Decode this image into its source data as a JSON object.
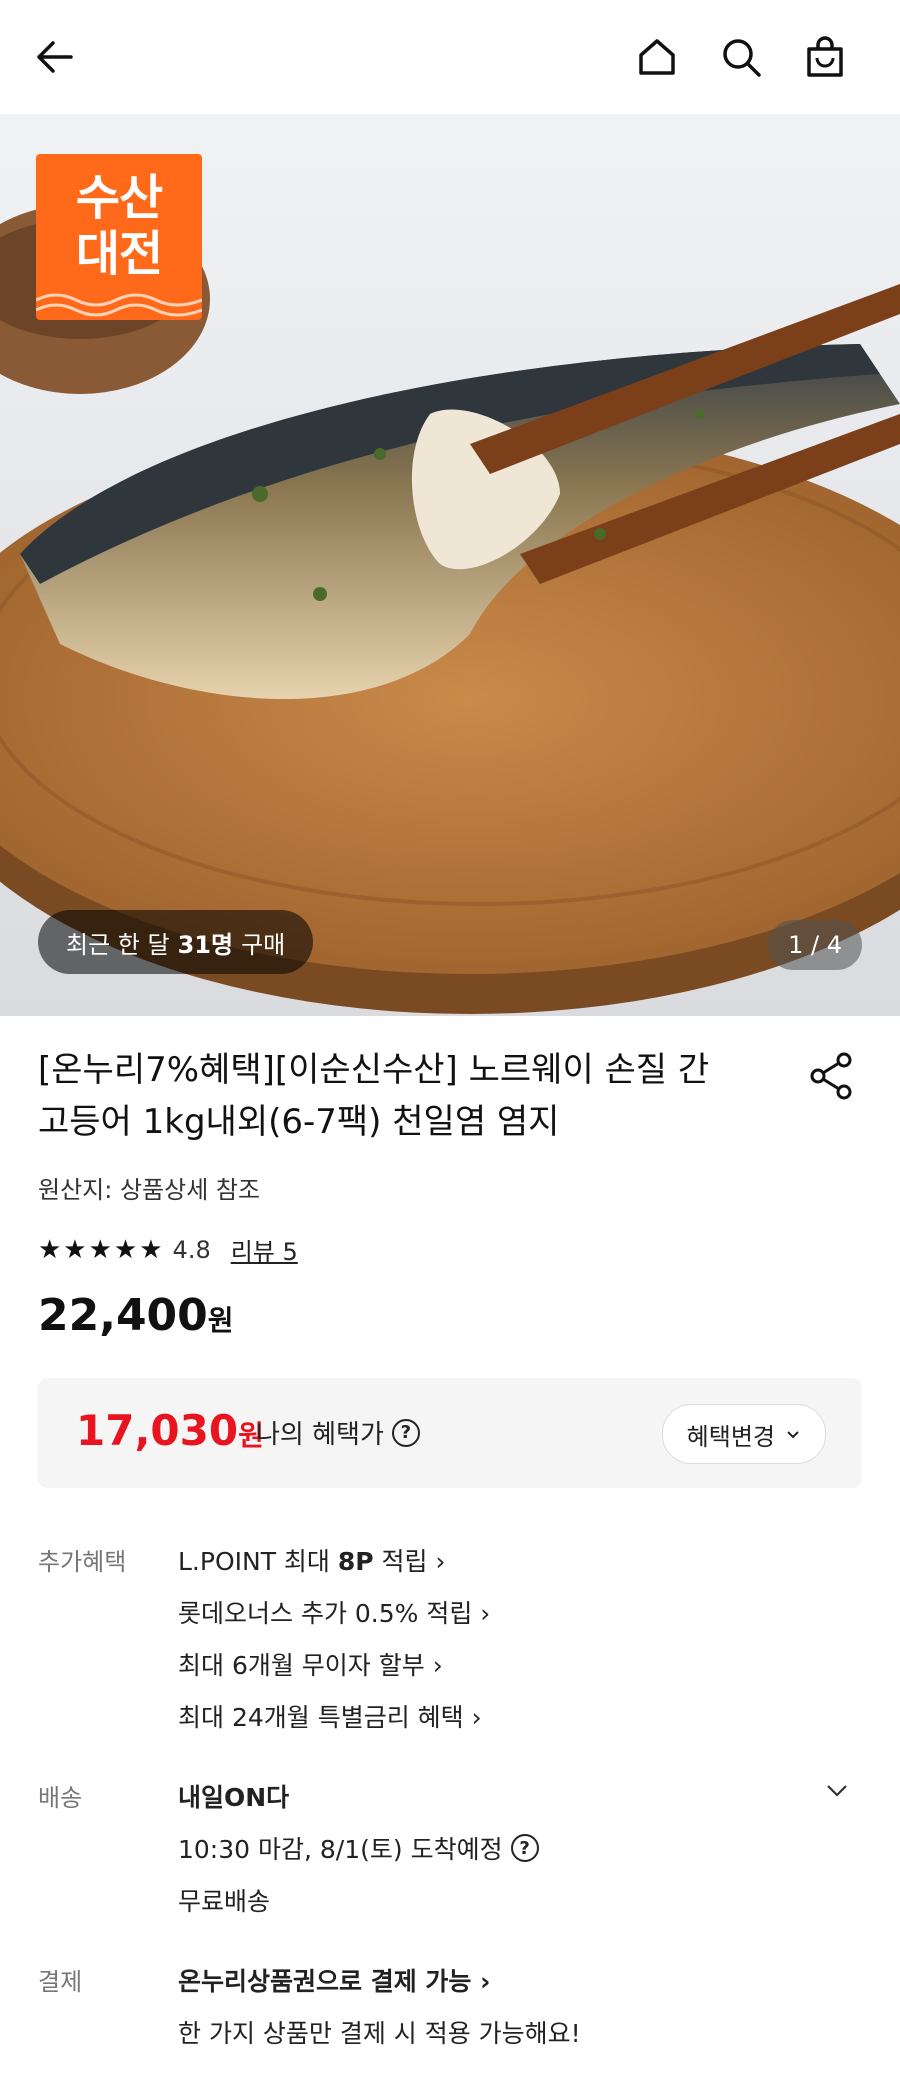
{
  "header": {
    "back_icon": "arrow-left-icon",
    "home_icon": "home-icon",
    "search_icon": "search-icon",
    "cart_icon": "shopping-bag-icon"
  },
  "hero": {
    "badge_line1": "수산",
    "badge_line2": "대전",
    "recent_prefix": "최근 한 달",
    "recent_count": "31명",
    "recent_suffix": "구매",
    "counter": "1 / 4",
    "badge_color": "#ff6a1a"
  },
  "product": {
    "title_line1": "[온누리7%혜택][이순신수산] 노르웨이 손질 간",
    "title_line2": "고등어 1kg내외(6-7팩) 천일염 염지",
    "origin": "원산지: 상품상세 참조",
    "stars": "★★★★★",
    "rating": "4.8",
    "reviews": "리뷰 5",
    "price": "22,400",
    "price_unit": "원"
  },
  "benefit": {
    "price": "17,030",
    "unit": "원",
    "label": "나의 혜택가",
    "change_button": "혜택변경",
    "accent": "#e8141f"
  },
  "extra": {
    "label": "추가혜택",
    "items": [
      {
        "pre": "L.POINT 최대 ",
        "bold": "8P",
        "post": " 적립 ›"
      },
      {
        "pre": "롯데오너스 추가 0.5% 적립 ›",
        "bold": "",
        "post": ""
      },
      {
        "pre": "최대 6개월 무이자 할부 ›",
        "bold": "",
        "post": ""
      },
      {
        "pre": "최대 24개월 특별금리 혜택 ›",
        "bold": "",
        "post": ""
      }
    ]
  },
  "delivery": {
    "label": "배송",
    "title": "내일ON다",
    "detail": "10:30 마감, 8/1(토) 도착예정",
    "free": "무료배송"
  },
  "payment": {
    "label": "결제",
    "title": "온누리상품권으로 결제 가능 ›",
    "note": "한 가지 상품만 결제 시 적용 가능해요!"
  }
}
